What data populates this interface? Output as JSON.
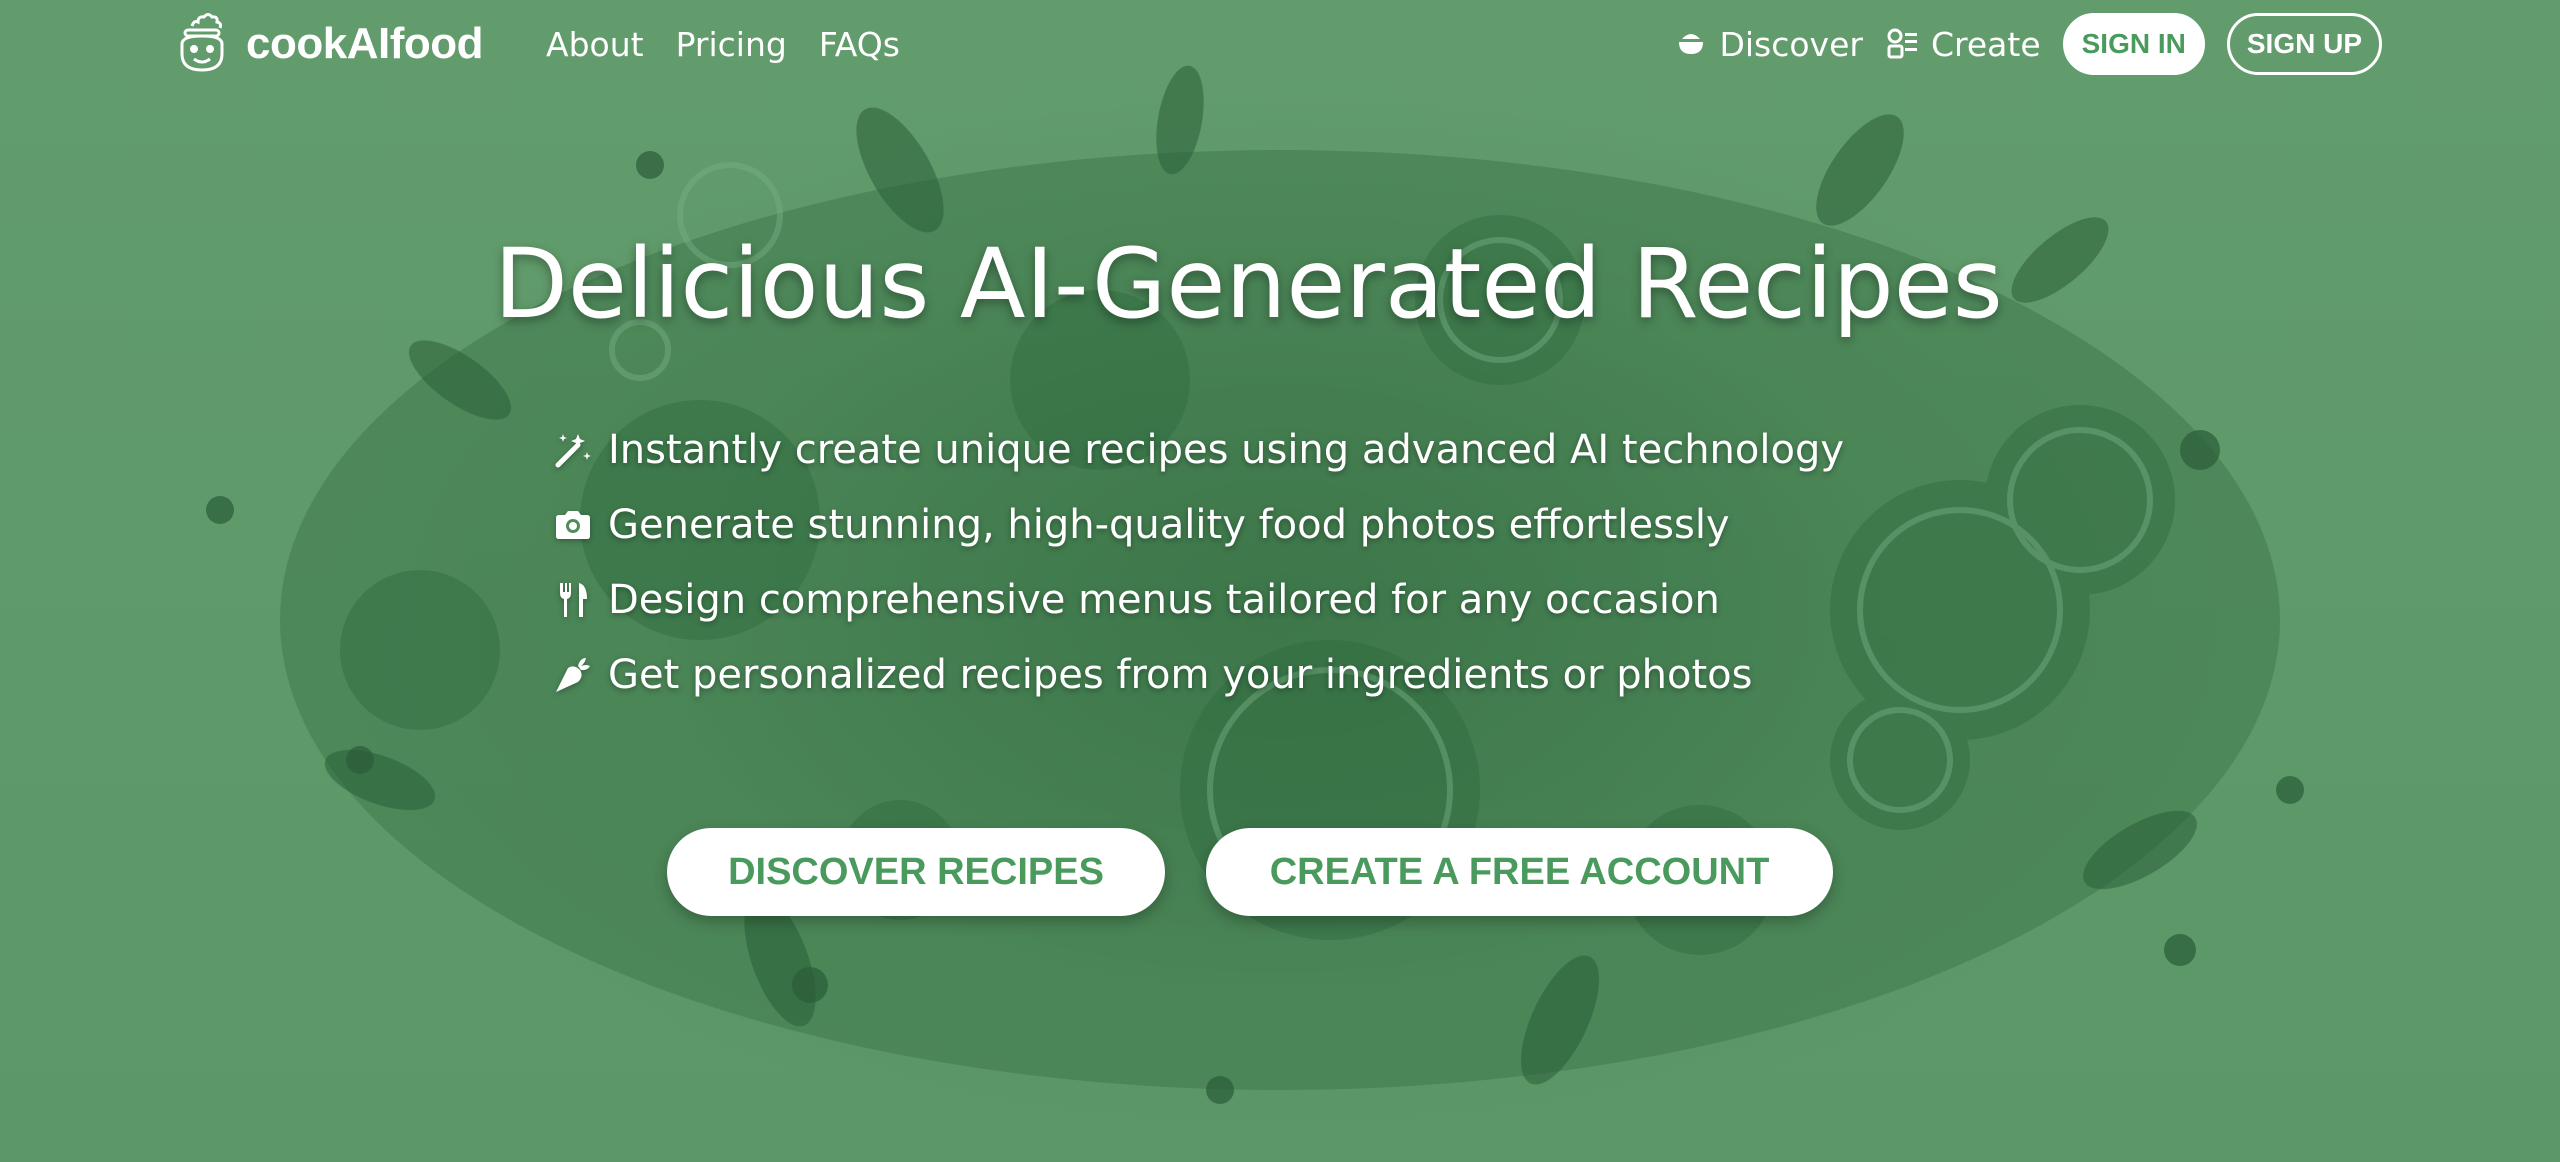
{
  "brand": {
    "name": "cookAIfood"
  },
  "nav": {
    "links": [
      {
        "label": "About"
      },
      {
        "label": "Pricing"
      },
      {
        "label": "FAQs"
      }
    ],
    "discover_label": "Discover",
    "create_label": "Create",
    "sign_in_label": "SIGN IN",
    "sign_up_label": "SIGN UP"
  },
  "hero": {
    "title": "Delicious AI-Generated Recipes",
    "features": [
      {
        "icon": "magic-wand-icon",
        "text": "Instantly create unique recipes using advanced AI technology"
      },
      {
        "icon": "camera-icon",
        "text": "Generate stunning, high-quality food photos effortlessly"
      },
      {
        "icon": "utensils-icon",
        "text": "Design comprehensive menus tailored for any occasion"
      },
      {
        "icon": "carrot-icon",
        "text": "Get personalized recipes from your ingredients or photos"
      }
    ],
    "cta_discover": "DISCOVER RECIPES",
    "cta_create": "CREATE A FREE ACCOUNT"
  },
  "colors": {
    "background": "#5f9a6a",
    "accent": "#4a9a5e",
    "text": "#ffffff"
  }
}
